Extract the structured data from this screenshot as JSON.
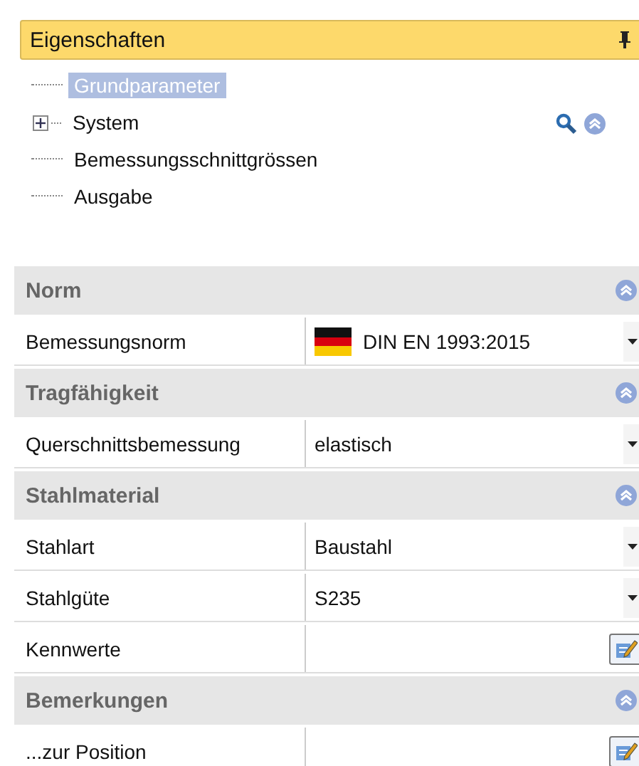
{
  "panel": {
    "title": "Eigenschaften"
  },
  "tree": [
    {
      "label": "Grundparameter",
      "kind": "leaf",
      "selected": true
    },
    {
      "label": "System",
      "kind": "node",
      "selected": false,
      "expanded": false
    },
    {
      "label": "Bemessungsschnittgrössen",
      "kind": "leaf",
      "selected": false
    },
    {
      "label": "Ausgabe",
      "kind": "leaf",
      "selected": false
    }
  ],
  "sections": [
    {
      "title": "Norm",
      "rows": [
        {
          "label": "Bemessungsnorm",
          "value": "DIN EN 1993:2015",
          "kind": "flag_dropdown"
        }
      ]
    },
    {
      "title": "Tragfähigkeit",
      "rows": [
        {
          "label": "Querschnittsbemessung",
          "value": "elastisch",
          "kind": "dropdown"
        }
      ]
    },
    {
      "title": "Stahlmaterial",
      "rows": [
        {
          "label": "Stahlart",
          "value": "Baustahl",
          "kind": "dropdown"
        },
        {
          "label": "Stahlgüte",
          "value": "S235",
          "kind": "dropdown"
        },
        {
          "label": "Kennwerte",
          "kind": "editor"
        }
      ]
    },
    {
      "title": "Bemerkungen",
      "rows": [
        {
          "label": "...zur Position",
          "kind": "editor"
        }
      ]
    }
  ]
}
